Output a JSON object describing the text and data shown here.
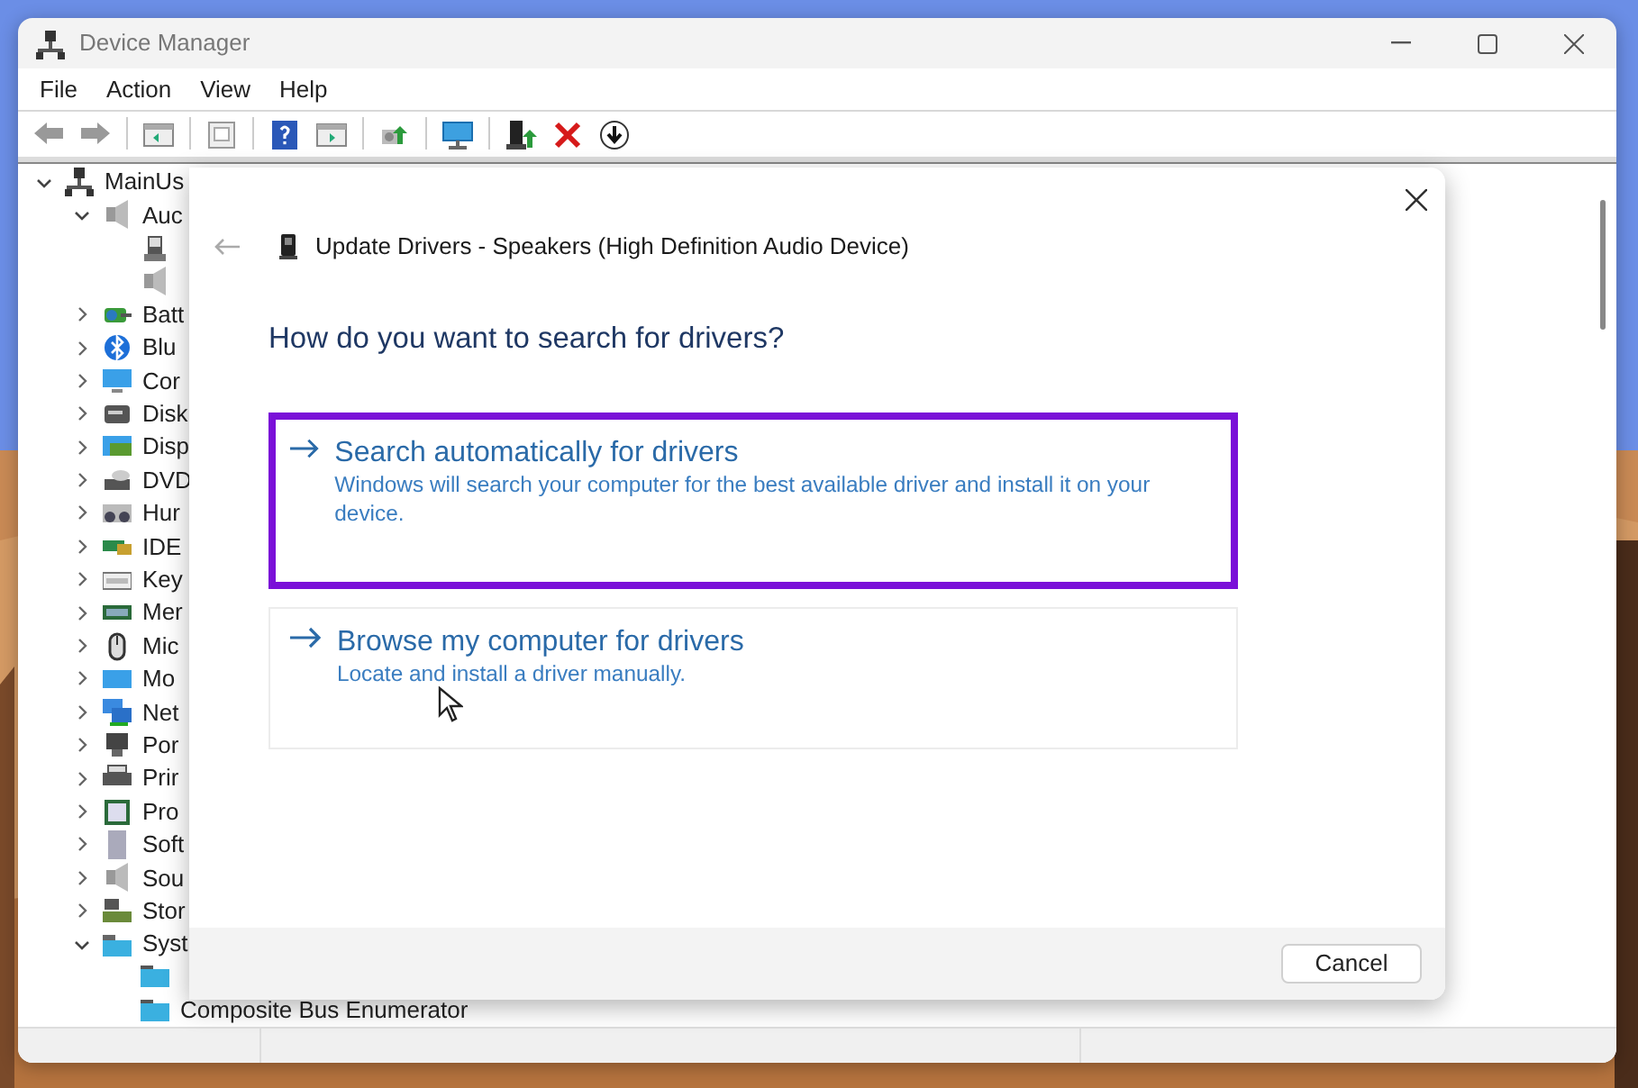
{
  "window": {
    "title": "Device Manager"
  },
  "menu": [
    "File",
    "Action",
    "View",
    "Help"
  ],
  "tree": {
    "label": "MainUs",
    "kind": "category",
    "expanded": true,
    "children": [
      {
        "label": "Auc",
        "kind": "category",
        "expanded": true,
        "children": [
          {
            "kind": "device"
          },
          {
            "kind": "device"
          }
        ]
      },
      {
        "label": "Batt",
        "kind": "category",
        "expanded": false
      },
      {
        "label": "Blu",
        "kind": "category",
        "expanded": false
      },
      {
        "label": "Cor",
        "kind": "category",
        "expanded": false
      },
      {
        "label": "Disk",
        "kind": "category",
        "expanded": false
      },
      {
        "label": "Disp",
        "kind": "category",
        "expanded": false
      },
      {
        "label": "DVD",
        "kind": "category",
        "expanded": false
      },
      {
        "label": "Hur",
        "kind": "category",
        "expanded": false
      },
      {
        "label": "IDE",
        "kind": "category",
        "expanded": false
      },
      {
        "label": "Key",
        "kind": "category",
        "expanded": false
      },
      {
        "label": "Mer",
        "kind": "category",
        "expanded": false
      },
      {
        "label": "Mic",
        "kind": "category",
        "expanded": false
      },
      {
        "label": "Mo",
        "kind": "category",
        "expanded": false
      },
      {
        "label": "Net",
        "kind": "category",
        "expanded": false
      },
      {
        "label": "Por",
        "kind": "category",
        "expanded": false
      },
      {
        "label": "Prir",
        "kind": "category",
        "expanded": false
      },
      {
        "label": "Pro",
        "kind": "category",
        "expanded": false
      },
      {
        "label": "Soft",
        "kind": "category",
        "expanded": false
      },
      {
        "label": "Sou",
        "kind": "category",
        "expanded": false
      },
      {
        "label": "Stor",
        "kind": "category",
        "expanded": false
      },
      {
        "label": "Syst",
        "kind": "category",
        "expanded": true,
        "children": [
          {
            "kind": "device"
          },
          {
            "label": "Composite Bus Enumerator",
            "kind": "device"
          }
        ]
      }
    ]
  },
  "dialog": {
    "title": "Update Drivers - Speakers (High Definition Audio Device)",
    "question": "How do you want to search for drivers?",
    "options": [
      {
        "title": "Search automatically for drivers",
        "description": "Windows will search your computer for the best available driver and install it on your device.",
        "highlighted": true
      },
      {
        "title": "Browse my computer for drivers",
        "description": "Locate and install a driver manually.",
        "highlighted": false
      }
    ],
    "buttons": [
      "Cancel"
    ]
  }
}
